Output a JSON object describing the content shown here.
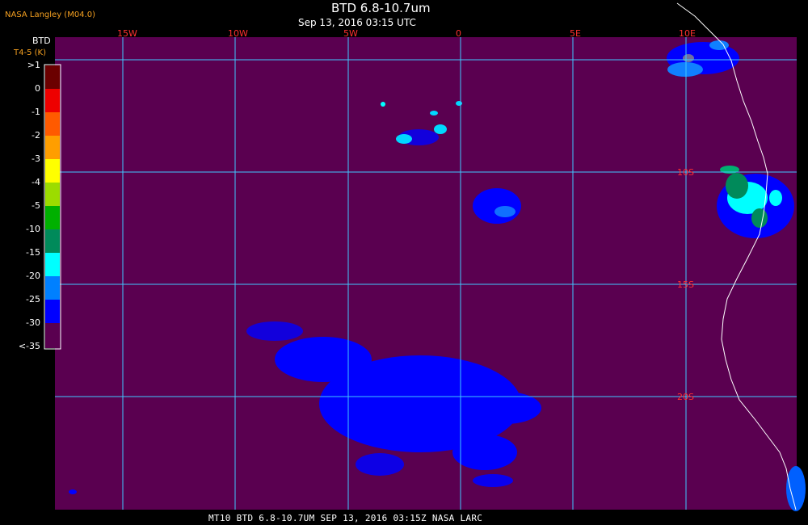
{
  "header": {
    "source_label": "NASA Langley (M04.0)",
    "title": "BTD 6.8-10.7um",
    "subtitle": "Sep 13, 2016 03:15 UTC"
  },
  "colorbar": {
    "title": "BTD",
    "units": "T4-5 (K)",
    "ticks": [
      ">1",
      "0",
      "-1",
      "-2",
      "-3",
      "-4",
      "-5",
      "-10",
      "-15",
      "-20",
      "-25",
      "-30",
      "<-35"
    ],
    "colors": [
      "#6b0000",
      "#ee0000",
      "#ff5a00",
      "#ff9e00",
      "#ffff00",
      "#9cdc00",
      "#00b000",
      "#008a5a",
      "#00ffff",
      "#0080ff",
      "#0000ff",
      "#5a0050"
    ]
  },
  "map": {
    "background": "#5a0050",
    "grid_color": "#40c8ff",
    "lon_labels": [
      "15W",
      "10W",
      "5W",
      "0",
      "5E",
      "10E"
    ],
    "lat_labels": [
      "10S",
      "15S",
      "20S"
    ]
  },
  "footer": {
    "text": "MT10  BTD 6.8-10.7UM   SEP 13, 2016 03:15Z   NASA LARC"
  }
}
